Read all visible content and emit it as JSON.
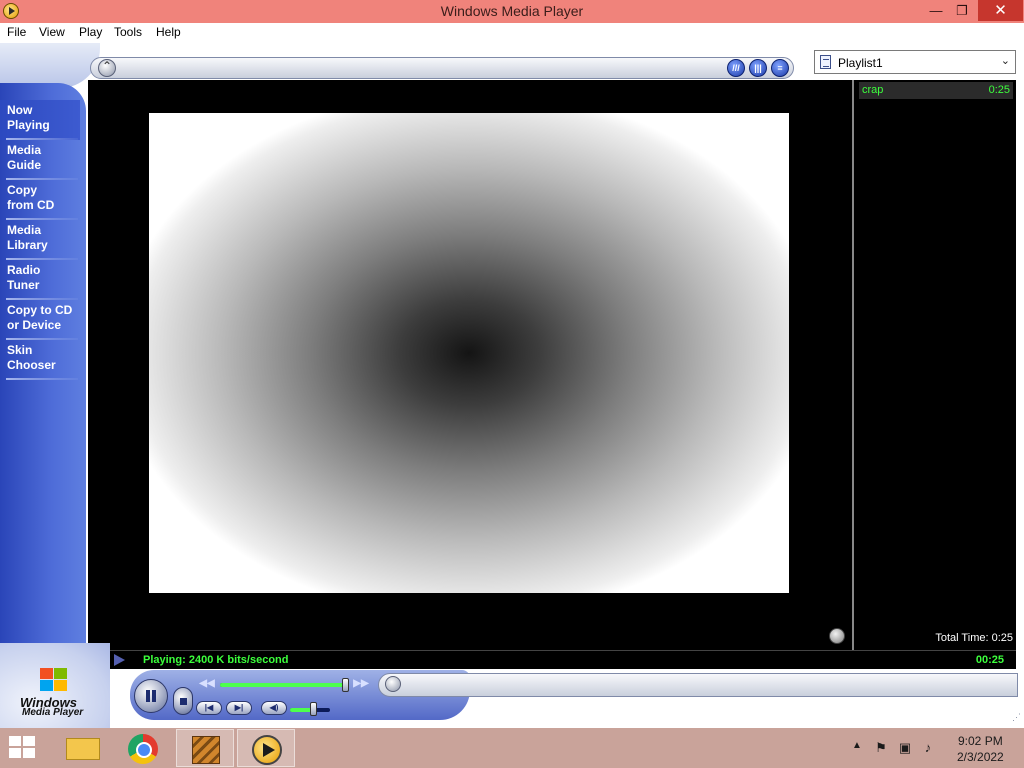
{
  "window": {
    "title": "Windows Media Player",
    "minimize": "—",
    "maximize": "❐",
    "close": "✕"
  },
  "menu": [
    "File",
    "View",
    "Play",
    "Tools",
    "Help"
  ],
  "sidebar": {
    "items": [
      {
        "line1": "Now",
        "line2": "Playing"
      },
      {
        "line1": "Media",
        "line2": "Guide"
      },
      {
        "line1": "Copy",
        "line2": "from CD"
      },
      {
        "line1": "Media",
        "line2": "Library"
      },
      {
        "line1": "Radio",
        "line2": "Tuner"
      },
      {
        "line1": "Copy to CD",
        "line2": "or Device"
      },
      {
        "line1": "Skin",
        "line2": "Chooser"
      }
    ],
    "active_index": 0,
    "logo_line1": "Windows",
    "logo_line2": "Media Player"
  },
  "playlist": {
    "selected": "Playlist1",
    "items": [
      {
        "name": "crap",
        "duration": "0:25"
      }
    ],
    "total_time": "Total Time: 0:25"
  },
  "status": {
    "text": "Playing: 2400 K bits/second",
    "elapsed": "00:25"
  },
  "controls": {
    "seek_fraction": 0.98,
    "volume_fraction": 0.55
  },
  "taskbar": {
    "apps": [
      "file-explorer",
      "google-chrome",
      "movie-maker",
      "windows-media-player"
    ],
    "active_app": "windows-media-player",
    "clock_time": "9:02 PM",
    "clock_date": "2/3/2022"
  },
  "colors": {
    "title_bar": "#f0837b",
    "status_green": "#3cff3c",
    "sidebar_blue": "#3e5bcc"
  }
}
